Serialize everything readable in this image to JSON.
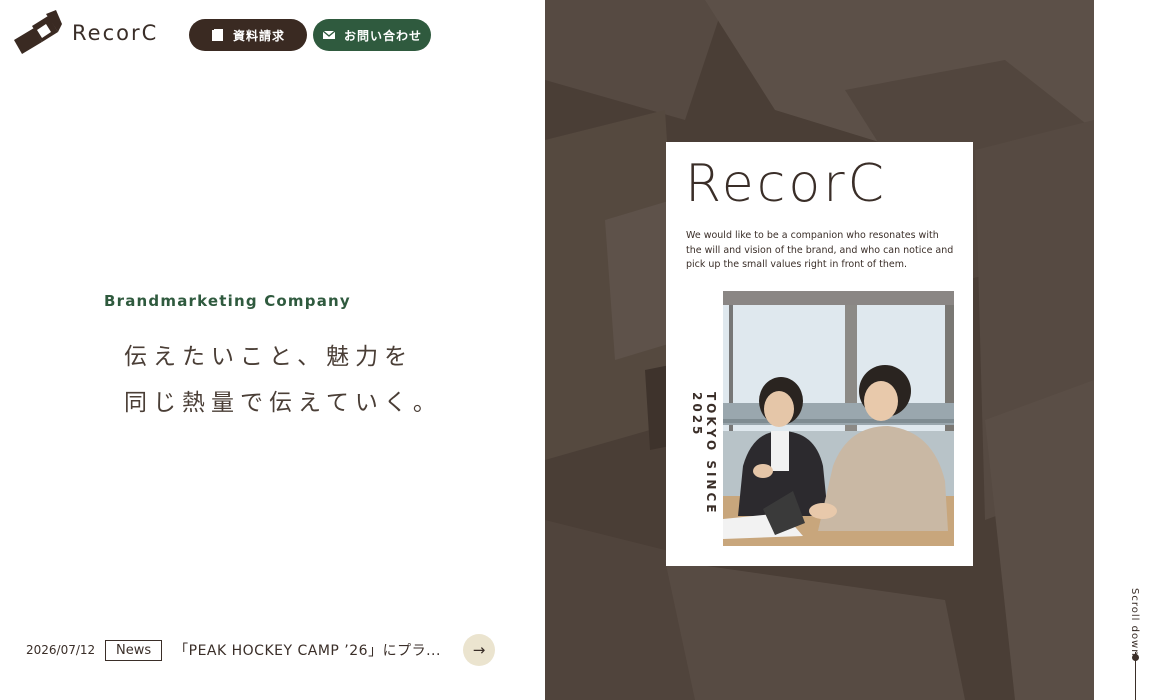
{
  "header": {
    "logo_text": "RecorC",
    "doc_button": "資料請求",
    "contact_button": "お問い合わせ"
  },
  "hero": {
    "tagline": "Brandmarketing Company",
    "headline_line1": "伝えたいこと、魅力を",
    "headline_line2": "同じ熱量で伝えていく。"
  },
  "cover": {
    "title": "RecorC",
    "copy": "We would like to be a companion who resonates with the will and vision of the brand, and who can notice and pick up the small values right in front of them.",
    "vertical": "TOKYO SINCE 2025"
  },
  "news": {
    "date": "2026/07/12",
    "tag": "News",
    "title": "「PEAK HOCKEY CAMP ’26」にプラ...",
    "arrow": "→"
  },
  "scroll": {
    "label": "Scroll down"
  },
  "colors": {
    "brand_dark": "#3a2a22",
    "brand_green": "#2f5a3e",
    "panel_brown": "#4a3e36",
    "arrow_bg": "#ebe4cf"
  }
}
